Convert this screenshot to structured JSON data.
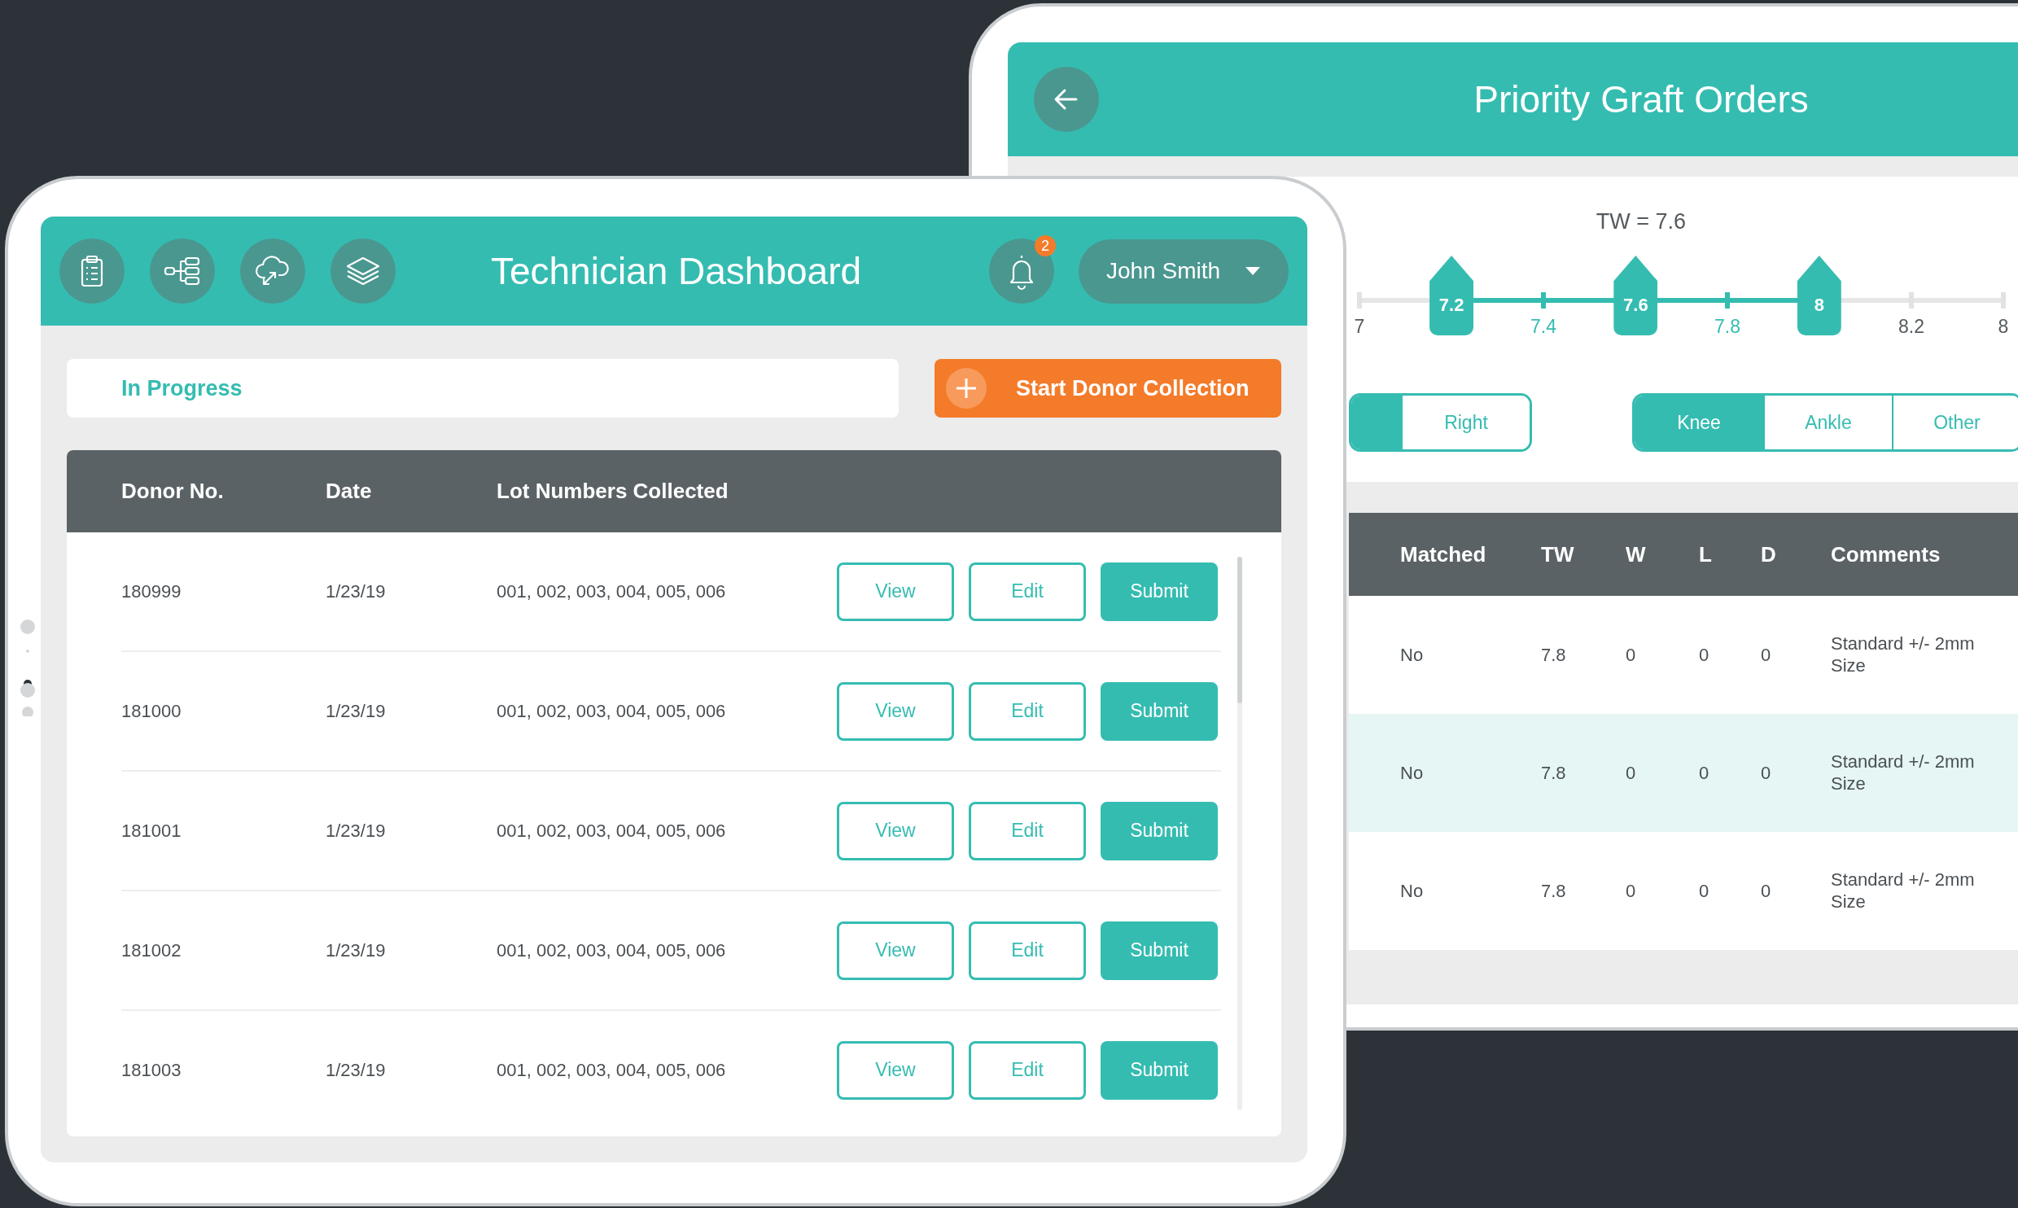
{
  "dashboard": {
    "header": {
      "title": "Technician Dashboard",
      "notification_count": "2",
      "user": "John Smith"
    },
    "status_filter": {
      "value": "In Progress"
    },
    "primary_action": "Start Donor Collection",
    "table": {
      "columns": [
        "Donor No.",
        "Date",
        "Lot Numbers Collected"
      ],
      "rows": [
        {
          "donor_no": "180999",
          "date": "1/23/19",
          "lots": "001, 002, 003, 004, 005, 006",
          "actions": [
            {
              "label": "View",
              "kind": "outline"
            },
            {
              "label": "Edit",
              "kind": "outline"
            },
            {
              "label": "Submit",
              "kind": "primary"
            }
          ]
        },
        {
          "donor_no": "181000",
          "date": "1/23/19",
          "lots": "001, 002, 003, 004, 005, 006",
          "actions": [
            {
              "label": "View",
              "kind": "outline"
            },
            {
              "label": "Edit",
              "kind": "outline"
            },
            {
              "label": "Submit",
              "kind": "primary"
            }
          ]
        },
        {
          "donor_no": "181001",
          "date": "1/23/19",
          "lots": "001, 002, 003, 004, 005, 006",
          "actions": [
            {
              "label": "View",
              "kind": "outline"
            },
            {
              "label": "Edit",
              "kind": "outline"
            },
            {
              "label": "Submit",
              "kind": "primary"
            }
          ]
        },
        {
          "donor_no": "181002",
          "date": "1/23/19",
          "lots": "001, 002, 003, 004, 005, 006",
          "actions": [
            {
              "label": "View",
              "kind": "outline"
            },
            {
              "label": "Edit",
              "kind": "outline"
            },
            {
              "label": "Submit",
              "kind": "primary"
            }
          ]
        },
        {
          "donor_no": "181003",
          "date": "1/23/19",
          "lots": "001, 002, 003, 004, 005, 006",
          "actions": [
            {
              "label": "View",
              "kind": "outline"
            },
            {
              "label": "Edit",
              "kind": "outline"
            },
            {
              "label": "Submit",
              "kind": "primary"
            }
          ]
        }
      ]
    }
  },
  "priority_orders": {
    "title": "Priority Graft Orders",
    "slider": {
      "label": "TW = 7.6",
      "ticks": [
        {
          "label": "7",
          "in_range": false
        },
        {
          "label": "7.4",
          "in_range": true
        },
        {
          "label": "7.8",
          "in_range": true
        },
        {
          "label": "8.2",
          "in_range": false
        },
        {
          "label": "8",
          "in_range": false
        }
      ],
      "thumbs": [
        {
          "label": "7.2",
          "level": 0.143
        },
        {
          "label": "7.6",
          "level": 0.429
        },
        {
          "label": "8",
          "level": 0.714
        }
      ]
    },
    "side_toggle": [
      {
        "selected": true
      },
      {
        "label": "Right",
        "selected": false
      }
    ],
    "joint_toggle": [
      {
        "label": "Knee",
        "selected": true
      },
      {
        "label": "Ankle",
        "selected": false
      },
      {
        "label": "Other",
        "selected": false
      }
    ],
    "table": {
      "columns": [
        "Matched",
        "TW",
        "W",
        "L",
        "D",
        "Comments"
      ],
      "rows": [
        {
          "matched": "No",
          "tw": "7.8",
          "w": "0",
          "l": "0",
          "d": "0",
          "comments": "Standard +/- 2mm Size",
          "selected": false
        },
        {
          "matched": "No",
          "tw": "7.8",
          "w": "0",
          "l": "0",
          "d": "0",
          "comments": "Standard +/- 2mm Size",
          "selected": true
        },
        {
          "matched": "No",
          "tw": "7.8",
          "w": "0",
          "l": "0",
          "d": "0",
          "comments": "Standard +/- 2mm Size",
          "selected": false
        }
      ]
    }
  }
}
